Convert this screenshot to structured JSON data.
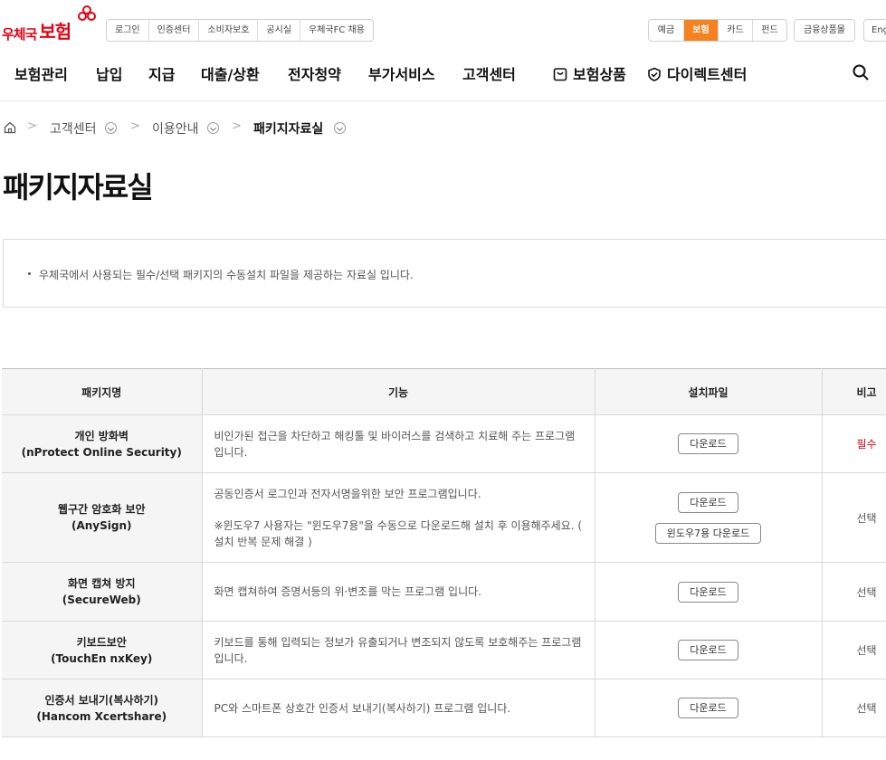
{
  "header": {
    "logo_text1": "우체국",
    "logo_text2": "보험",
    "util_links": [
      "로그인",
      "인증센터",
      "소비자보호",
      "공시실",
      "우체국FC 채용"
    ],
    "categories": [
      "예금",
      "보험",
      "카드",
      "펀드"
    ],
    "active_category": "보험",
    "financial_mall": "금융상품몰",
    "lang": "Eng",
    "brand_color": "#e60012",
    "accent_color": "#f5821f"
  },
  "gnb": {
    "items": [
      "보험관리",
      "납입",
      "지급",
      "대출/상환",
      "전자청약",
      "부가서비스",
      "고객센터"
    ],
    "product": "보험상품",
    "direct": "다이렉트센터"
  },
  "breadcrumb": {
    "level1": "고객센터",
    "level2": "이용안내",
    "current": "패키지자료실"
  },
  "page": {
    "title": "패키지자료실",
    "info": "우체국에서 사용되는 필수/선택 패키지의 수동설치 파일을 제공하는 자료실 입니다."
  },
  "table": {
    "headers": [
      "패키지명",
      "기능",
      "설치파일",
      "비고"
    ],
    "rows": [
      {
        "name": "개인 방화벽",
        "sub": "(nProtect Online Security)",
        "desc": "비인가된 접근을 차단하고 해킹툴 및 바이러스를 검색하고 치료해 주는 프로그램입니다.",
        "desc2": "",
        "button": "다운로드",
        "button2": "",
        "note": "필수"
      },
      {
        "name": "웹구간 암호화 보안",
        "sub": "(AnySign)",
        "desc": "공동인증서 로그인과 전자서명을위한 보안 프로그램입니다.",
        "desc2": "※윈도우7 사용자는 \"윈도우7용\"을 수동으로 다운로드해 설치 후 이용해주세요. ( 설치 반복 문제 해결 )",
        "button": "다운로드",
        "button2": "윈도우7용 다운로드",
        "note": "선택"
      },
      {
        "name": "화면 캡쳐 방지",
        "sub": "(SecureWeb)",
        "desc": "화면 캡쳐하여 증명서등의 위·변조를 막는 프로그램 입니다.",
        "desc2": "",
        "button": "다운로드",
        "button2": "",
        "note": "선택"
      },
      {
        "name": "키보드보안",
        "sub": "(TouchEn nxKey)",
        "desc": "키보드를 통해 입력되는 정보가 유출되거나 변조되지 않도록 보호해주는 프로그램입니다.",
        "desc2": "",
        "button": "다운로드",
        "button2": "",
        "note": "선택"
      },
      {
        "name": "인증서 보내기(복사하기)",
        "sub": "(Hancom Xcertshare)",
        "desc": "PC와 스마트폰 상호간 인증서 보내기(복사하기) 프로그램 입니다.",
        "desc2": "",
        "button": "다운로드",
        "button2": "",
        "note": "선택"
      }
    ]
  }
}
